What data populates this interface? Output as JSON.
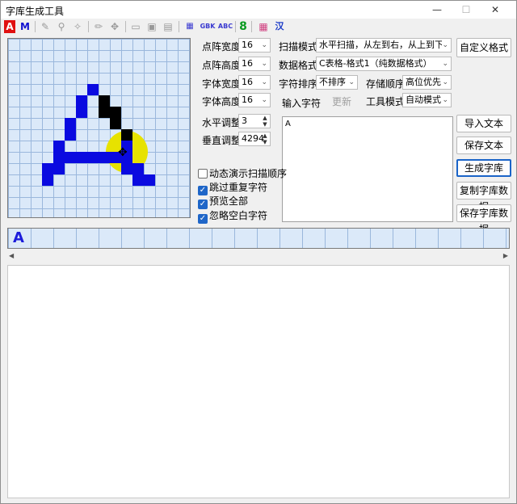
{
  "window": {
    "title": "字库生成工具"
  },
  "titlebar": {
    "min": "—",
    "max": "☐",
    "close": "✕"
  },
  "toolbar": {
    "a_red": "A",
    "m_blue": "M",
    "gbk": "GBK",
    "abc": "ABC",
    "eight": "8",
    "han": "汉"
  },
  "colors": {
    "pixel": "#0a0ae0",
    "pixel_sel": "#000000",
    "highlight": "#e7e200",
    "accent": "#1a64c8"
  },
  "settings": {
    "dot_width_label": "点阵宽度",
    "dot_width": "16",
    "dot_height_label": "点阵高度",
    "dot_height": "16",
    "font_width_label": "字体宽度",
    "font_width": "16",
    "font_height_label": "字体高度",
    "font_height": "16",
    "scan_mode_label": "扫描模式",
    "scan_mode": "水平扫描，从左到右，从上到下",
    "data_format_label": "数据格式",
    "data_format": "C表格-格式1（纯数据格式）",
    "char_sort_label": "字符排序",
    "char_sort": "不排序",
    "storage_order_label": "存储顺序",
    "storage_order": "高位优先",
    "input_char_label": "输入字符",
    "update_label": "更新",
    "tool_mode_label": "工具模式",
    "tool_mode": "自动模式",
    "h_adjust_label": "水平调整",
    "h_adjust": "3",
    "v_adjust_label": "垂直调整",
    "v_adjust": "4294"
  },
  "buttons": {
    "custom_format": "自定义格式",
    "import_text": "导入文本",
    "save_text": "保存文本",
    "generate": "生成字库",
    "copy_data": "复制字库数据",
    "save_data": "保存字库数据"
  },
  "checkboxes": [
    {
      "label": "动态演示扫描顺序",
      "checked": false
    },
    {
      "label": "跳过重复字符",
      "checked": true
    },
    {
      "label": "预览全部",
      "checked": true
    },
    {
      "label": "忽略空白字符",
      "checked": true
    }
  ],
  "input_text": "A",
  "preview_strip": {
    "glyph": "A"
  },
  "icons": [
    "font-red-icon",
    "font-blue-icon",
    "eraser-icon",
    "move-icon",
    "open-icon",
    "save-icon",
    "grid-icon",
    "palette-icon"
  ]
}
